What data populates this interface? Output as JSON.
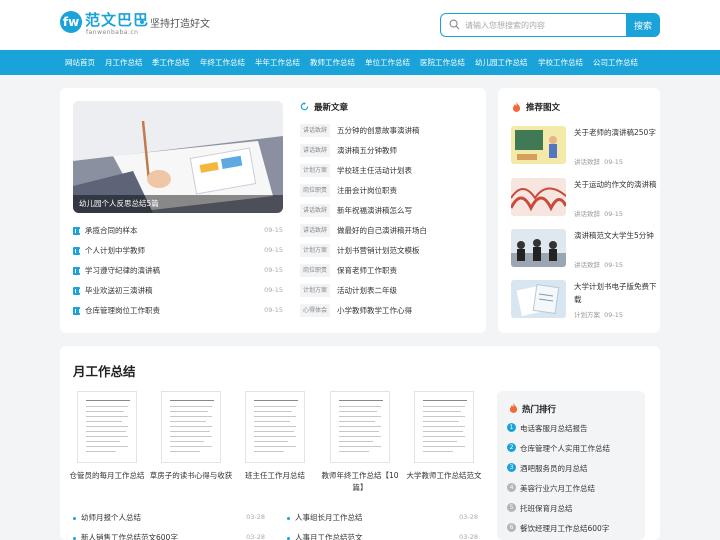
{
  "header": {
    "logo_mark": "fw",
    "logo_name": "范文巴巴",
    "logo_sub": "fanwenbaba.cn",
    "slogan": "坚持打造好文",
    "search_placeholder": "请输入您想搜索的内容",
    "search_button": "搜索"
  },
  "colors": {
    "accent": "#1aa3d9",
    "tag_bg": "#f1f3f5",
    "rank_top": "#1aa3d9",
    "rank_other": "#b5b5b5"
  },
  "nav": [
    "网站首页",
    "月工作总结",
    "季工作总结",
    "年终工作总结",
    "半年工作总结",
    "教师工作总结",
    "单位工作总结",
    "医院工作总结",
    "幼儿园工作总结",
    "学校工作总结",
    "公司工作总结"
  ],
  "featured": {
    "caption": "幼儿园个人反思总结5篇"
  },
  "left_list": [
    {
      "title": "承揽合同的样本",
      "date": "09-15"
    },
    {
      "title": "个人计划中学教师",
      "date": "09-15"
    },
    {
      "title": "学习遵守纪律的演讲稿",
      "date": "09-15"
    },
    {
      "title": "毕业欢送初三演讲稿",
      "date": "09-15"
    },
    {
      "title": "仓库管理岗位工作职责",
      "date": "09-15"
    }
  ],
  "latest": {
    "title": "最新文章",
    "items": [
      {
        "tag": "讲话致辞",
        "title": "五分钟的创意故事演讲稿"
      },
      {
        "tag": "讲话致辞",
        "title": "演讲稿五分钟教师"
      },
      {
        "tag": "计划方案",
        "title": "学校班主任活动计划表"
      },
      {
        "tag": "岗位职责",
        "title": "注册会计岗位职责"
      },
      {
        "tag": "讲话致辞",
        "title": "新年祝福演讲稿怎么写"
      },
      {
        "tag": "讲话致辞",
        "title": "做最好的自己演讲稿开场白"
      },
      {
        "tag": "计划方案",
        "title": "计划书营销计划范文模板"
      },
      {
        "tag": "岗位职责",
        "title": "保育老师工作职责"
      },
      {
        "tag": "计划方案",
        "title": "活动计划表二年级"
      },
      {
        "tag": "心得体会",
        "title": "小学教师教学工作心得"
      }
    ]
  },
  "recommended": {
    "title": "推荐图文",
    "items": [
      {
        "title": "关于老师的演讲稿250字",
        "tag": "讲话致辞",
        "date": "09-15"
      },
      {
        "title": "关于运动的作文的演讲稿",
        "tag": "讲话致辞",
        "date": "09-15"
      },
      {
        "title": "演讲稿范文大学生5分钟",
        "tag": "讲话致辞",
        "date": "09-15"
      },
      {
        "title": "大学计划书电子版免费下载",
        "tag": "计划方案",
        "date": "09-15"
      }
    ]
  },
  "month": {
    "title": "月工作总结",
    "cards": [
      {
        "caption": "仓管员的每月工作总结"
      },
      {
        "caption": "草房子的读书心得与收获"
      },
      {
        "caption": "班主任工作月总结"
      },
      {
        "caption": "教师年终工作总结【10篇】"
      },
      {
        "caption": "大学教师工作总结范文"
      }
    ],
    "bottom_left": [
      {
        "title": "幼师月报个人总结",
        "date": "03-28"
      },
      {
        "title": "新人销售工作总结范文600字",
        "date": "03-28"
      }
    ],
    "bottom_right": [
      {
        "title": "人事组长月工作总结",
        "date": "03-28"
      },
      {
        "title": "人事月工作总结范文",
        "date": "03-28"
      }
    ]
  },
  "hot": {
    "title": "热门排行",
    "items": [
      {
        "rank": "1",
        "title": "电话客服月总结报告"
      },
      {
        "rank": "2",
        "title": "仓库管理个人实用工作总结"
      },
      {
        "rank": "3",
        "title": "酒吧服务员的月总结"
      },
      {
        "rank": "4",
        "title": "美容行业六月工作总结"
      },
      {
        "rank": "5",
        "title": "托班保育月总结"
      },
      {
        "rank": "6",
        "title": "餐饮经理月工作总结600字"
      }
    ]
  }
}
